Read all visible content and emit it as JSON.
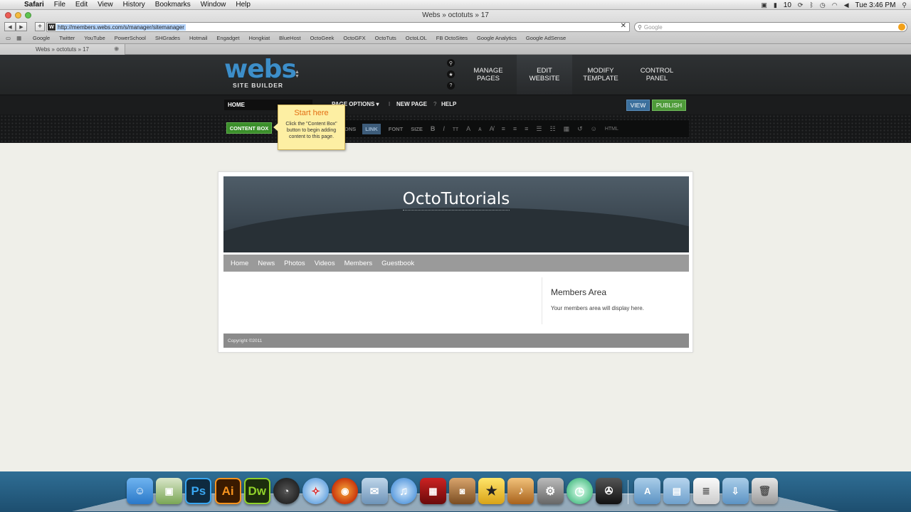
{
  "menubar": {
    "app_name": "Safari",
    "items": [
      "File",
      "Edit",
      "View",
      "History",
      "Bookmarks",
      "Window",
      "Help"
    ],
    "battery_num": "10",
    "clock": "Tue 3:46 PM"
  },
  "browser": {
    "window_title": "Webs » octotuts » 17",
    "url": "http://members.webs.com/s/manager/sitemanager",
    "search_placeholder": "Google",
    "bookmarks": [
      "Google",
      "Twitter",
      "YouTube",
      "PowerSchool",
      "SHGrades",
      "Hotmail",
      "Engadget",
      "Hongkiat",
      "BlueHost",
      "OctoGeek",
      "OctoGFX",
      "OctoTuts",
      "OctoLOL",
      "FB OctoSites",
      "Google Analytics",
      "Google AdSense"
    ],
    "tab_title": "Webs » octotuts » 17"
  },
  "webs": {
    "logo_word": "webs",
    "logo_sub": "SITE BUILDER",
    "nav": [
      {
        "label": "MANAGE\nPAGES"
      },
      {
        "label": "EDIT\nWEBSITE"
      },
      {
        "label": "MODIFY\nTEMPLATE"
      },
      {
        "label": "CONTROL\nPANEL"
      }
    ],
    "page_select": "HOME",
    "page_options": "PAGE OPTIONS ▾",
    "new_page": "NEW PAGE",
    "help": "HELP",
    "view": "VIEW",
    "publish": "PUBLISH",
    "content_box": "CONTENT BOX",
    "partial_options": "ONS",
    "link": "LINK",
    "font": "FONT",
    "size": "SIZE"
  },
  "tooltip": {
    "title": "Start here",
    "body": "Click the \"Content Box\" button to begin adding content to this page."
  },
  "site": {
    "title": "OctoTutorials",
    "nav": [
      "Home",
      "News",
      "Photos",
      "Videos",
      "Members",
      "Guestbook"
    ],
    "members_title": "Members Area",
    "members_desc": "Your members area will display here.",
    "copyright": "Copyright ©2011"
  },
  "colors": {
    "webs_blue": "#3d8ec9",
    "publish_green": "#4e9b39",
    "view_blue": "#3b6f9c",
    "tooltip_title": "#e36e13"
  },
  "dock": [
    "finder-icon",
    "preview-icon",
    "photoshop-icon",
    "illustrator-icon",
    "dreamweaver-icon",
    "dashboard-icon",
    "safari-icon",
    "firefox-icon",
    "mail-icon",
    "itunes-icon",
    "photo-booth-icon",
    "iphoto-icon",
    "imovie-icon",
    "garageband-icon",
    "system-preferences-icon",
    "time-machine-icon",
    "final-cut-icon",
    "applications-folder-icon",
    "documents-folder-icon",
    "text-file-icon",
    "downloads-folder-icon",
    "trash-icon"
  ]
}
